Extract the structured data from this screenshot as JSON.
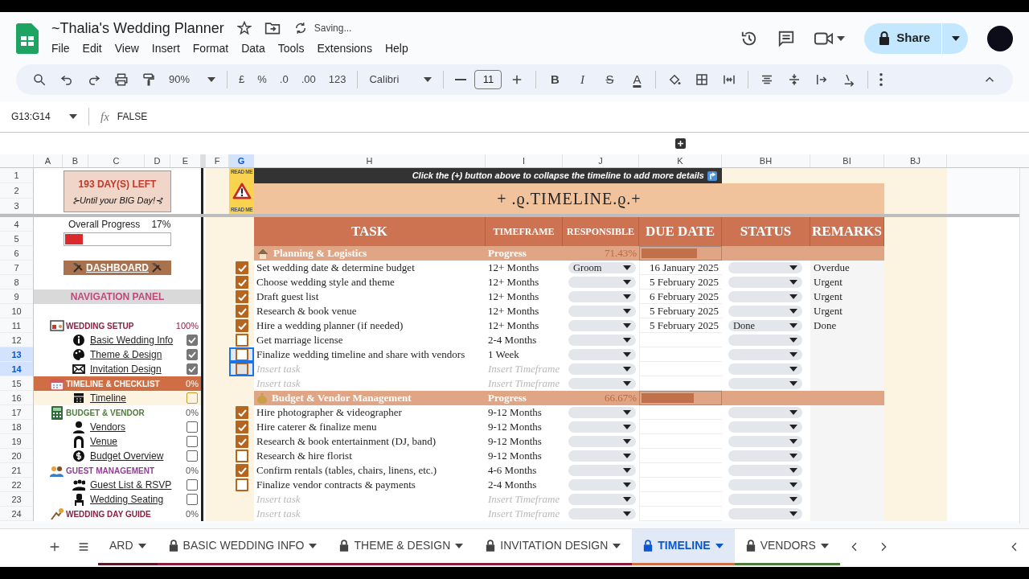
{
  "app": {
    "title": "~Thalia's Wedding Planner",
    "save_status": "Saving...",
    "share_label": "Share"
  },
  "menu": [
    "File",
    "Edit",
    "View",
    "Insert",
    "Format",
    "Data",
    "Tools",
    "Extensions",
    "Help"
  ],
  "toolbar": {
    "zoom": "90%",
    "number_formats": [
      "£",
      "%",
      ".0",
      ".00",
      "123"
    ],
    "font": "Calibri",
    "font_size": "11",
    "style_buttons": [
      "B",
      "I",
      "S",
      "A"
    ]
  },
  "formula_bar": {
    "name_box": "G13:G14",
    "fx": "fx",
    "value": "FALSE"
  },
  "columns_left": [
    {
      "label": "A",
      "selected": false
    },
    {
      "label": "B",
      "selected": false
    },
    {
      "label": "C",
      "selected": false
    },
    {
      "label": "D",
      "selected": false
    },
    {
      "label": "E",
      "selected": false
    }
  ],
  "columns_right": [
    {
      "label": "F",
      "selected": false
    },
    {
      "label": "G",
      "selected": true
    },
    {
      "label": "H",
      "selected": false
    },
    {
      "label": "I",
      "selected": false
    },
    {
      "label": "J",
      "selected": false
    },
    {
      "label": "K",
      "selected": false
    },
    {
      "label": "BH",
      "selected": false
    },
    {
      "label": "BI",
      "selected": false
    },
    {
      "label": "BJ",
      "selected": false
    }
  ],
  "row_numbers": [
    {
      "label": "1",
      "selected": false
    },
    {
      "label": "2",
      "selected": false
    },
    {
      "label": "3",
      "selected": false
    },
    {
      "label": "4",
      "selected": false
    },
    {
      "label": "5",
      "selected": false
    },
    {
      "label": "6",
      "selected": false
    },
    {
      "label": "7",
      "selected": false
    },
    {
      "label": "8",
      "selected": false
    },
    {
      "label": "9",
      "selected": false
    },
    {
      "label": "10",
      "selected": false
    },
    {
      "label": "11",
      "selected": false
    },
    {
      "label": "12",
      "selected": false
    },
    {
      "label": "13",
      "selected": true
    },
    {
      "label": "14",
      "selected": true
    },
    {
      "label": "15",
      "selected": false
    },
    {
      "label": "16",
      "selected": false
    },
    {
      "label": "17",
      "selected": false
    },
    {
      "label": "18",
      "selected": false
    },
    {
      "label": "19",
      "selected": false
    },
    {
      "label": "20",
      "selected": false
    },
    {
      "label": "21",
      "selected": false
    },
    {
      "label": "22",
      "selected": false
    },
    {
      "label": "23",
      "selected": false
    },
    {
      "label": "24",
      "selected": false
    }
  ],
  "countdown": {
    "days": "193 DAY(S) LEFT",
    "subtitle": "⊱Until your BIG Day!⊰"
  },
  "overall_progress": {
    "label": "Overall Progress",
    "value": "17%",
    "level": 0.17
  },
  "dashboard_button": "DASHBOARD",
  "navigation_title": "NAVIGATION PANEL",
  "nav": [
    {
      "kind": "section",
      "label": "WEDDING SETUP",
      "value": "100%",
      "color": "#8b1e3f",
      "selected": false
    },
    {
      "kind": "item",
      "label": "Basic Wedding Info",
      "checked": true
    },
    {
      "kind": "item",
      "label": "Theme & Design",
      "checked": true
    },
    {
      "kind": "item",
      "label": "Invitation Design",
      "checked": true
    },
    {
      "kind": "section",
      "label": "TIMELINE & CHECKLIST",
      "value": "0%",
      "color": "#cf6e44",
      "selected": true
    },
    {
      "kind": "item",
      "label": "Timeline",
      "checked": false
    },
    {
      "kind": "section",
      "label": "BUDGET & VENDOR",
      "value": "0%",
      "color": "#4e7d3b",
      "selected": false
    },
    {
      "kind": "item",
      "label": "Vendors",
      "checked": false
    },
    {
      "kind": "item",
      "label": "Venue",
      "checked": false
    },
    {
      "kind": "item",
      "label": "Budget Overview",
      "checked": false
    },
    {
      "kind": "section",
      "label": "GUEST MANAGEMENT",
      "value": "0%",
      "color": "#8d3f8f",
      "selected": false
    },
    {
      "kind": "item",
      "label": "Guest List & RSVP",
      "checked": false
    },
    {
      "kind": "item",
      "label": "Wedding Seating",
      "checked": false
    },
    {
      "kind": "section",
      "label": "WEDDING DAY GUIDE",
      "value": "0%",
      "color": "#8b1e3f",
      "selected": false
    }
  ],
  "readme": {
    "top": "READ ME",
    "bottom": "READ ME"
  },
  "banner": "Click the (+) button above to collapse the timeline to add more details",
  "timeline_title": "+ .ϱ.TIMELINE.ϱ.+",
  "headers": [
    "TASK",
    "TIMEFRAME",
    "RESPONSIBLE",
    "DUE DATE",
    "STATUS",
    "REMARKS"
  ],
  "groups": [
    {
      "title": "Planning & Logistics",
      "progress_label": "Progress",
      "progress_value": "71.43%",
      "level": 0.7143,
      "tasks": [
        {
          "kind": "task",
          "checked": true,
          "selected": false,
          "task": "Set wedding date & determine budget",
          "timeframe": "12+ Months",
          "responsible": "Groom",
          "due_date": "16 January 2025",
          "remarks": "Overdue"
        },
        {
          "kind": "task",
          "checked": true,
          "selected": false,
          "task": "Choose wedding style and theme",
          "timeframe": "12+ Months",
          "due_date": "5 February 2025",
          "remarks": "Urgent"
        },
        {
          "kind": "task",
          "checked": true,
          "selected": false,
          "task": "Draft guest list",
          "timeframe": "12+ Months",
          "due_date": "6 February 2025",
          "remarks": "Urgent"
        },
        {
          "kind": "task",
          "checked": true,
          "selected": false,
          "task": "Research & book venue",
          "timeframe": "12+ Months",
          "due_date": "5 February 2025",
          "remarks": "Urgent"
        },
        {
          "kind": "task",
          "checked": true,
          "selected": false,
          "task": "Hire a wedding planner (if needed)",
          "timeframe": "12+ Months",
          "due_date": "5 February 2025",
          "status": "Done",
          "remarks": "Done"
        },
        {
          "kind": "task",
          "checked": false,
          "selected": false,
          "task": "Get marriage license",
          "timeframe": "2-4 Months"
        },
        {
          "kind": "task",
          "checked": false,
          "selected": true,
          "task": "Finalize wedding timeline and share with vendors",
          "timeframe": "1 Week"
        },
        {
          "kind": "placeholder",
          "checked": false,
          "selected": true,
          "task": "Insert task",
          "timeframe": "Insert Timeframe"
        },
        {
          "kind": "placeholder",
          "selected": false,
          "task": "Insert task",
          "timeframe": "Insert Timeframe"
        }
      ]
    },
    {
      "title": "Budget & Vendor Management",
      "progress_label": "Progress",
      "progress_value": "66.67%",
      "level": 0.6667,
      "tasks": [
        {
          "kind": "task",
          "checked": true,
          "selected": false,
          "task": "Hire photographer & videographer",
          "timeframe": "9-12 Months"
        },
        {
          "kind": "task",
          "checked": true,
          "selected": false,
          "task": "Hire caterer & finalize menu",
          "timeframe": "9-12 Months"
        },
        {
          "kind": "task",
          "checked": true,
          "selected": false,
          "task": "Research & book entertainment (DJ, band)",
          "timeframe": "9-12 Months"
        },
        {
          "kind": "task",
          "checked": false,
          "selected": false,
          "task": "Research & hire florist",
          "timeframe": "9-12 Months"
        },
        {
          "kind": "task",
          "checked": true,
          "selected": false,
          "task": "Confirm rentals (tables, chairs, linens, etc.)",
          "timeframe": "4-6 Months"
        },
        {
          "kind": "task",
          "checked": false,
          "selected": false,
          "task": "Finalize vendor contracts & payments",
          "timeframe": "2-4 Months"
        },
        {
          "kind": "placeholder",
          "selected": false,
          "task": "Insert task",
          "timeframe": "Insert Timeframe"
        },
        {
          "kind": "placeholder",
          "selected": false,
          "task": "Insert task",
          "timeframe": "Insert Timeframe"
        }
      ]
    }
  ],
  "sheet_tabs": [
    {
      "label": "ARD",
      "locked": false,
      "selected": false,
      "color": "#5a1a2a"
    },
    {
      "label": "BASIC WEDDING INFO",
      "locked": true,
      "selected": false,
      "color": "#8b1e3f"
    },
    {
      "label": "THEME & DESIGN",
      "locked": true,
      "selected": false,
      "color": "#8b1e3f"
    },
    {
      "label": "INVITATION DESIGN",
      "locked": true,
      "selected": false,
      "color": "#8b1e3f"
    },
    {
      "label": "TIMELINE",
      "locked": true,
      "selected": true,
      "color": "#cf6e44"
    },
    {
      "label": "VENDORS",
      "locked": true,
      "selected": false,
      "color": "#4e7d3b"
    }
  ]
}
